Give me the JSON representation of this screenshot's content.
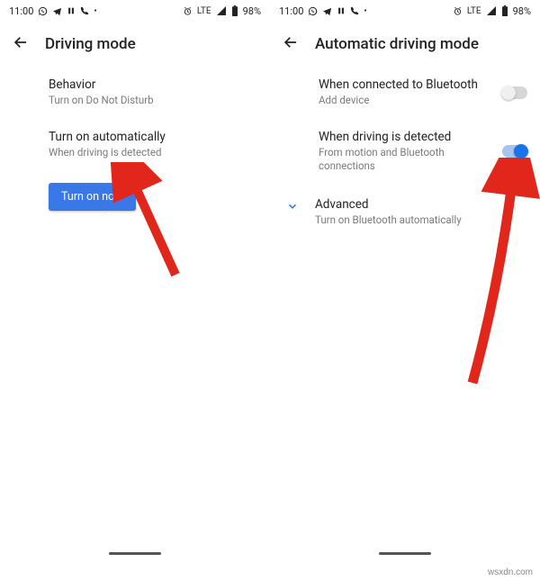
{
  "status": {
    "time": "11:00",
    "network": "LTE",
    "battery_text": "98%"
  },
  "left": {
    "title": "Driving mode",
    "behavior": {
      "label": "Behavior",
      "sub": "Turn on Do Not Disturb"
    },
    "auto": {
      "label": "Turn on automatically",
      "sub": "When driving is detected"
    },
    "button": "Turn on now"
  },
  "right": {
    "title": "Automatic driving mode",
    "bluetooth": {
      "label": "When connected to Bluetooth",
      "sub": "Add device"
    },
    "driving": {
      "label": "When driving is detected",
      "sub": "From motion and Bluetooth connections"
    },
    "advanced": {
      "label": "Advanced",
      "sub": "Turn on Bluetooth automatically"
    }
  },
  "watermark": "wsxdn.com"
}
